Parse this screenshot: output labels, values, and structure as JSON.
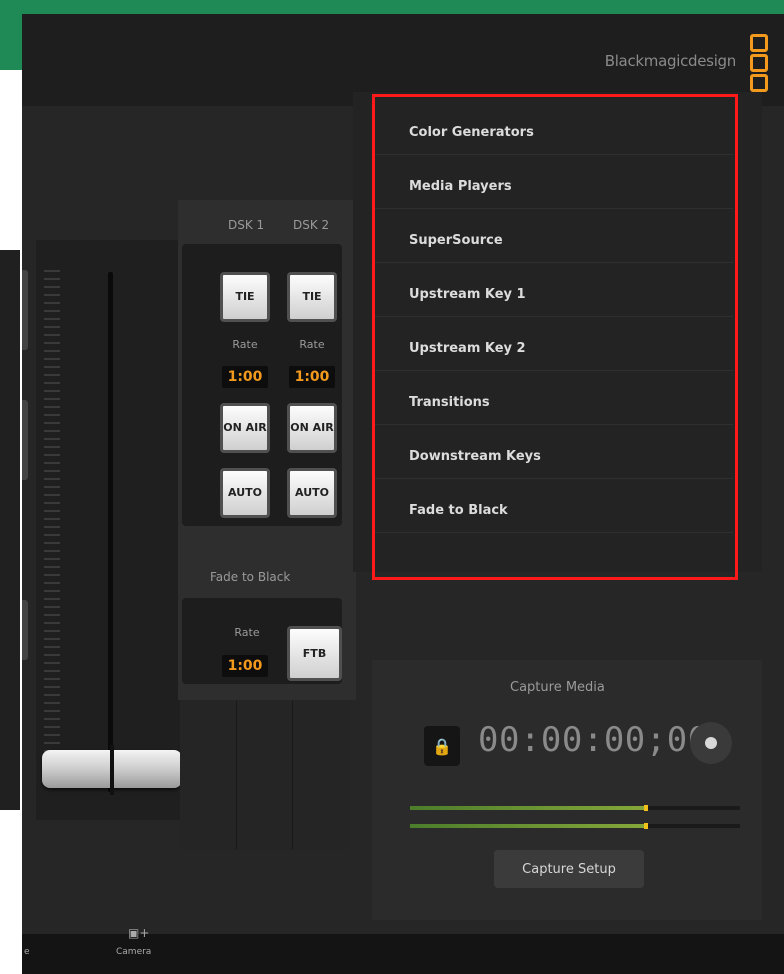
{
  "brand": {
    "logo_text": "Blackmagicdesign"
  },
  "menu": {
    "items": [
      {
        "label": "Color Generators"
      },
      {
        "label": "Media Players"
      },
      {
        "label": "SuperSource"
      },
      {
        "label": "Upstream Key 1"
      },
      {
        "label": "Upstream Key 2"
      },
      {
        "label": "Transitions"
      },
      {
        "label": "Downstream Keys"
      },
      {
        "label": "Fade to Black"
      }
    ]
  },
  "dsk": {
    "dsk1": {
      "title": "DSK 1",
      "tie": "TIE",
      "rate_label": "Rate",
      "rate_value": "1:00",
      "on_air": "ON AIR",
      "auto": "AUTO"
    },
    "dsk2": {
      "title": "DSK 2",
      "tie": "TIE",
      "rate_label": "Rate",
      "rate_value": "1:00",
      "on_air": "ON AIR",
      "auto": "AUTO"
    }
  },
  "fade_to_black": {
    "title": "Fade to Black",
    "rate_label": "Rate",
    "rate_value": "1:00",
    "button": "FTB"
  },
  "capture": {
    "title": "Capture Media",
    "timecode": "00:00:00;00",
    "setup_button": "Capture Setup",
    "meter_levels": [
      0.72,
      0.72
    ]
  },
  "footer": {
    "camera_label": "Camera"
  },
  "colors": {
    "accent": "#f39a1e",
    "highlight": "#ff1a1a",
    "frame_green": "#1f8a56"
  }
}
